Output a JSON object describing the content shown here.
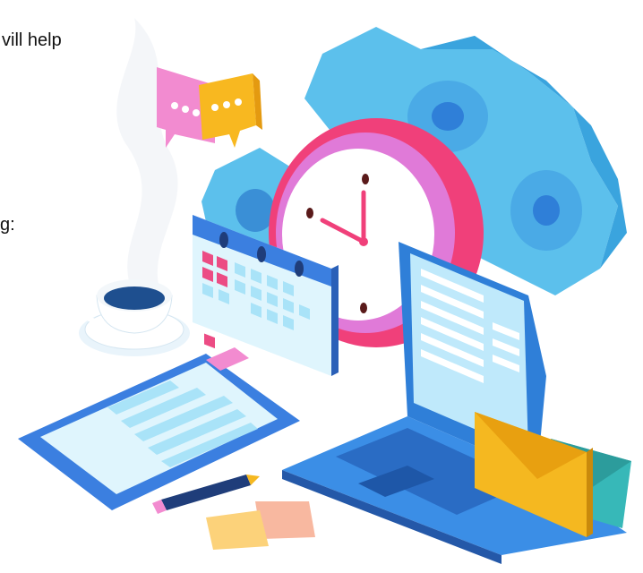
{
  "text_fragments": {
    "line_1": "vill help",
    "line_2": "g:"
  },
  "colors": {
    "gear": "#5cc0ec",
    "gear_dark": "#3a8fd6",
    "clock_ring": "#f0407a",
    "laptop_body": "#2f7fd8",
    "screen": "#bfe9fb",
    "envelope_orange": "#f5b820",
    "envelope_teal": "#37b8b8",
    "chat_pink": "#f28bd0",
    "chat_orange": "#f8b820",
    "calendar_blue": "#3b7fe0",
    "calendar_pink": "#ec4c84"
  },
  "icons": [
    "gear-icon",
    "clock-icon",
    "calendar-icon",
    "laptop-icon",
    "envelope-icon",
    "clipboard-icon",
    "coffee-cup-icon",
    "speech-bubble-icon",
    "pencil-icon",
    "sticky-note-icon"
  ]
}
